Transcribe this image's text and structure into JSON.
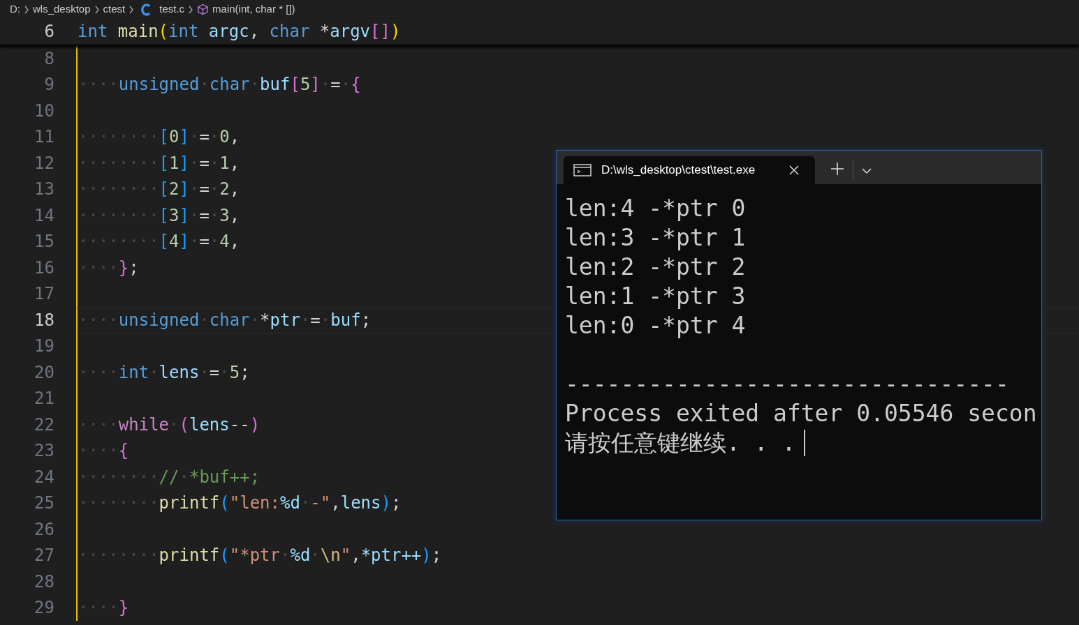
{
  "breadcrumb": [
    {
      "text": "D:",
      "kind": "folder"
    },
    {
      "text": "wls_desktop",
      "kind": "folder"
    },
    {
      "text": "ctest",
      "kind": "folder"
    },
    {
      "text": "test.c",
      "kind": "file"
    },
    {
      "text": "main(int, char * [])",
      "kind": "symbol"
    }
  ],
  "sticky_line": {
    "number": "6",
    "tokens": [
      {
        "text": "int ",
        "kind": "keyword"
      },
      {
        "text": "main",
        "kind": "function"
      },
      {
        "text": "(",
        "kind": "bracket1"
      },
      {
        "text": "int ",
        "kind": "keyword"
      },
      {
        "text": "argc",
        "kind": "variable"
      },
      {
        "text": ", ",
        "kind": "punct"
      },
      {
        "text": "char",
        "kind": "keyword"
      },
      {
        "text": " *",
        "kind": "punct"
      },
      {
        "text": "argv",
        "kind": "variable"
      },
      {
        "text": "[]",
        "kind": "bracket2"
      },
      {
        "text": ")",
        "kind": "bracket1"
      }
    ]
  },
  "lines": [
    {
      "number": "8",
      "current": false
    },
    {
      "number": "9",
      "current": false,
      "tokens": [
        {
          "text": "····",
          "kind": "ws"
        },
        {
          "text": "unsigned",
          "kind": "keyword"
        },
        {
          "text": "·",
          "kind": "ws"
        },
        {
          "text": "char",
          "kind": "keyword"
        },
        {
          "text": "·",
          "kind": "ws"
        },
        {
          "text": "buf",
          "kind": "variable"
        },
        {
          "text": "[",
          "kind": "bracket2"
        },
        {
          "text": "5",
          "kind": "number"
        },
        {
          "text": "]",
          "kind": "bracket2"
        },
        {
          "text": "·",
          "kind": "ws"
        },
        {
          "text": "=",
          "kind": "punct"
        },
        {
          "text": "·",
          "kind": "ws"
        },
        {
          "text": "{",
          "kind": "bracket2"
        }
      ]
    },
    {
      "number": "10",
      "current": false
    },
    {
      "number": "11",
      "current": false,
      "tokens": [
        {
          "text": "········",
          "kind": "ws"
        },
        {
          "text": "[",
          "kind": "bracket3"
        },
        {
          "text": "0",
          "kind": "number"
        },
        {
          "text": "]",
          "kind": "bracket3"
        },
        {
          "text": "·",
          "kind": "ws"
        },
        {
          "text": "=",
          "kind": "punct"
        },
        {
          "text": "·",
          "kind": "ws"
        },
        {
          "text": "0",
          "kind": "number"
        },
        {
          "text": ",",
          "kind": "punct"
        }
      ]
    },
    {
      "number": "12",
      "current": false,
      "tokens": [
        {
          "text": "········",
          "kind": "ws"
        },
        {
          "text": "[",
          "kind": "bracket3"
        },
        {
          "text": "1",
          "kind": "number"
        },
        {
          "text": "]",
          "kind": "bracket3"
        },
        {
          "text": "·",
          "kind": "ws"
        },
        {
          "text": "=",
          "kind": "punct"
        },
        {
          "text": "·",
          "kind": "ws"
        },
        {
          "text": "1",
          "kind": "number"
        },
        {
          "text": ",",
          "kind": "punct"
        }
      ]
    },
    {
      "number": "13",
      "current": false,
      "tokens": [
        {
          "text": "········",
          "kind": "ws"
        },
        {
          "text": "[",
          "kind": "bracket3"
        },
        {
          "text": "2",
          "kind": "number"
        },
        {
          "text": "]",
          "kind": "bracket3"
        },
        {
          "text": "·",
          "kind": "ws"
        },
        {
          "text": "=",
          "kind": "punct"
        },
        {
          "text": "·",
          "kind": "ws"
        },
        {
          "text": "2",
          "kind": "number"
        },
        {
          "text": ",",
          "kind": "punct"
        }
      ]
    },
    {
      "number": "14",
      "current": false,
      "tokens": [
        {
          "text": "········",
          "kind": "ws"
        },
        {
          "text": "[",
          "kind": "bracket3"
        },
        {
          "text": "3",
          "kind": "number"
        },
        {
          "text": "]",
          "kind": "bracket3"
        },
        {
          "text": "·",
          "kind": "ws"
        },
        {
          "text": "=",
          "kind": "punct"
        },
        {
          "text": "·",
          "kind": "ws"
        },
        {
          "text": "3",
          "kind": "number"
        },
        {
          "text": ",",
          "kind": "punct"
        }
      ]
    },
    {
      "number": "15",
      "current": false,
      "tokens": [
        {
          "text": "········",
          "kind": "ws"
        },
        {
          "text": "[",
          "kind": "bracket3"
        },
        {
          "text": "4",
          "kind": "number"
        },
        {
          "text": "]",
          "kind": "bracket3"
        },
        {
          "text": "·",
          "kind": "ws"
        },
        {
          "text": "=",
          "kind": "punct"
        },
        {
          "text": "·",
          "kind": "ws"
        },
        {
          "text": "4",
          "kind": "number"
        },
        {
          "text": ",",
          "kind": "punct"
        }
      ]
    },
    {
      "number": "16",
      "current": false,
      "tokens": [
        {
          "text": "····",
          "kind": "ws"
        },
        {
          "text": "}",
          "kind": "bracket2"
        },
        {
          "text": ";",
          "kind": "punct"
        }
      ]
    },
    {
      "number": "17",
      "current": false
    },
    {
      "number": "18",
      "current": true,
      "tokens": [
        {
          "text": "····",
          "kind": "ws"
        },
        {
          "text": "unsigned",
          "kind": "keyword"
        },
        {
          "text": "·",
          "kind": "ws"
        },
        {
          "text": "char",
          "kind": "keyword"
        },
        {
          "text": "·",
          "kind": "ws"
        },
        {
          "text": "*",
          "kind": "punct"
        },
        {
          "text": "ptr",
          "kind": "variable"
        },
        {
          "text": "·",
          "kind": "ws"
        },
        {
          "text": "=",
          "kind": "punct"
        },
        {
          "text": "·",
          "kind": "ws"
        },
        {
          "text": "buf",
          "kind": "variable"
        },
        {
          "text": ";",
          "kind": "punct"
        }
      ]
    },
    {
      "number": "19",
      "current": false
    },
    {
      "number": "20",
      "current": false,
      "tokens": [
        {
          "text": "····",
          "kind": "ws"
        },
        {
          "text": "int",
          "kind": "keyword"
        },
        {
          "text": "·",
          "kind": "ws"
        },
        {
          "text": "lens",
          "kind": "variable"
        },
        {
          "text": "·",
          "kind": "ws"
        },
        {
          "text": "=",
          "kind": "punct"
        },
        {
          "text": "·",
          "kind": "ws"
        },
        {
          "text": "5",
          "kind": "number"
        },
        {
          "text": ";",
          "kind": "punct"
        }
      ]
    },
    {
      "number": "21",
      "current": false
    },
    {
      "number": "22",
      "current": false,
      "tokens": [
        {
          "text": "····",
          "kind": "ws"
        },
        {
          "text": "while",
          "kind": "control"
        },
        {
          "text": "·",
          "kind": "ws"
        },
        {
          "text": "(",
          "kind": "bracket2"
        },
        {
          "text": "lens",
          "kind": "variable"
        },
        {
          "text": "--",
          "kind": "punct"
        },
        {
          "text": ")",
          "kind": "bracket2"
        }
      ]
    },
    {
      "number": "23",
      "current": false,
      "tokens": [
        {
          "text": "····",
          "kind": "ws"
        },
        {
          "text": "{",
          "kind": "bracket2"
        }
      ]
    },
    {
      "number": "24",
      "current": false,
      "tokens": [
        {
          "text": "········",
          "kind": "ws"
        },
        {
          "text": "//",
          "kind": "comment"
        },
        {
          "text": "·",
          "kind": "ws"
        },
        {
          "text": "*buf++;",
          "kind": "comment"
        }
      ]
    },
    {
      "number": "25",
      "current": false,
      "tokens": [
        {
          "text": "········",
          "kind": "ws"
        },
        {
          "text": "printf",
          "kind": "function"
        },
        {
          "text": "(",
          "kind": "bracket3"
        },
        {
          "text": "\"len:",
          "kind": "string"
        },
        {
          "text": "%d",
          "kind": "variable"
        },
        {
          "text": "·",
          "kind": "ws"
        },
        {
          "text": "-\"",
          "kind": "string"
        },
        {
          "text": ",",
          "kind": "punct"
        },
        {
          "text": "lens",
          "kind": "variable"
        },
        {
          "text": ")",
          "kind": "bracket3"
        },
        {
          "text": ";",
          "kind": "punct"
        }
      ]
    },
    {
      "number": "26",
      "current": false
    },
    {
      "number": "27",
      "current": false,
      "tokens": [
        {
          "text": "········",
          "kind": "ws"
        },
        {
          "text": "printf",
          "kind": "function"
        },
        {
          "text": "(",
          "kind": "bracket3"
        },
        {
          "text": "\"*ptr",
          "kind": "string"
        },
        {
          "text": "·",
          "kind": "ws"
        },
        {
          "text": "%d",
          "kind": "variable"
        },
        {
          "text": "·",
          "kind": "ws"
        },
        {
          "text": "\\n",
          "kind": "escape"
        },
        {
          "text": "\"",
          "kind": "string"
        },
        {
          "text": ",",
          "kind": "punct"
        },
        {
          "text": "*ptr++",
          "kind": "variable"
        },
        {
          "text": ")",
          "kind": "bracket3"
        },
        {
          "text": ";",
          "kind": "punct"
        }
      ]
    },
    {
      "number": "28",
      "current": false
    },
    {
      "number": "29",
      "current": false,
      "tokens": [
        {
          "text": "····",
          "kind": "ws"
        },
        {
          "text": "}",
          "kind": "bracket2"
        }
      ]
    }
  ],
  "terminal": {
    "tab": {
      "title": "D:\\wls_desktop\\ctest\\test.exe",
      "selected": true
    },
    "output": [
      {
        "kind": "text",
        "text": "len:4 -*ptr 0"
      },
      {
        "kind": "text",
        "text": "len:3 -*ptr 1"
      },
      {
        "kind": "text",
        "text": "len:2 -*ptr 2"
      },
      {
        "kind": "text",
        "text": "len:1 -*ptr 3"
      },
      {
        "kind": "text",
        "text": "len:0 -*ptr 4"
      },
      {
        "kind": "blank"
      },
      {
        "kind": "text",
        "text": "--------------------------------"
      },
      {
        "kind": "text",
        "text": "Process exited after 0.05546 secon"
      },
      {
        "kind": "prompt",
        "text": "请按任意键继续. . ."
      }
    ]
  }
}
